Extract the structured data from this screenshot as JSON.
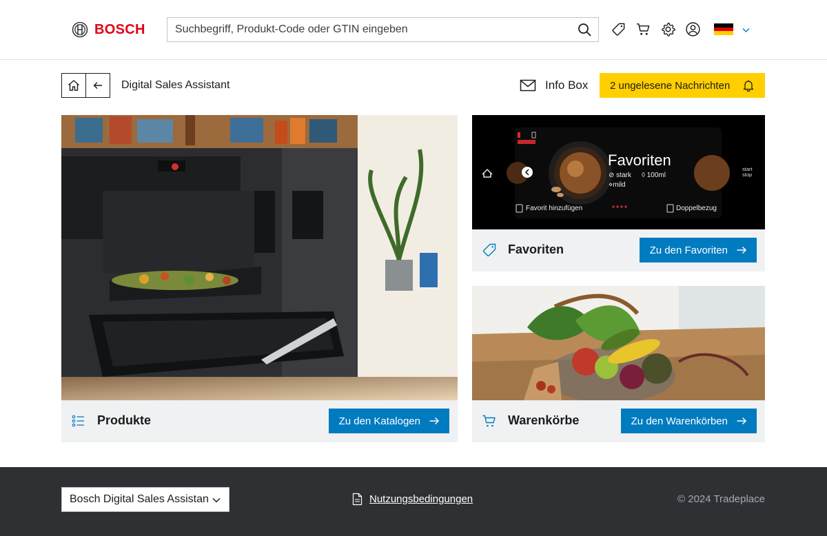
{
  "header": {
    "brand": "BOSCH",
    "search": {
      "placeholder": "Suchbegriff, Produkt-Code oder GTIN eingeben",
      "value": ""
    },
    "icons": [
      "tag-icon",
      "cart-icon",
      "gear-icon",
      "user-icon"
    ],
    "country_flag": "de"
  },
  "subnav": {
    "breadcrumb": "Digital Sales Assistant",
    "infobox_label": "Info Box",
    "notification_label": "2 ungelesene Nachrichten"
  },
  "cards": {
    "produkte": {
      "title": "Produkte",
      "cta": "Zu den Katalogen"
    },
    "favoriten": {
      "title": "Favoriten",
      "cta": "Zu den Favoriten",
      "screen": {
        "heading": "Favoriten",
        "strength": "stark",
        "volume": "100ml",
        "taste": "mild",
        "start_stop": "start stop",
        "add_favorite": "Favorit hinzufügen",
        "double_serving": "Doppelbezug"
      }
    },
    "warenkoerbe": {
      "title": "Warenkörbe",
      "cta": "Zu den Warenkörben"
    }
  },
  "footer": {
    "app_select": "Bosch Digital Sales Assistan",
    "terms": "Nutzungsbedingungen",
    "copyright": "© 2024 Tradeplace"
  },
  "colors": {
    "brand_red": "#e20015",
    "primary_blue": "#007bc0",
    "notification_yellow": "#ffcf00",
    "footer_bg": "#2e3033",
    "card_bg": "#eff1f2"
  }
}
